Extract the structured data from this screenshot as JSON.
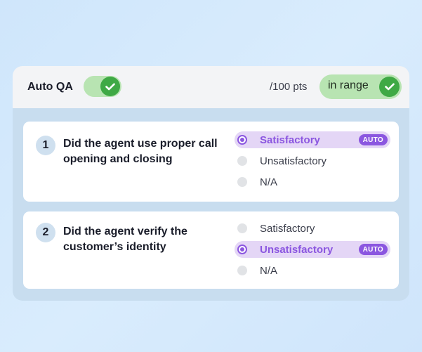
{
  "header": {
    "title": "Auto QA",
    "toggle_on": true,
    "score_text": "/100 pts",
    "range_label": "in range"
  },
  "questions": [
    {
      "number": "1",
      "text": "Did the agent use proper call opening and closing",
      "options": [
        {
          "label": "Satisfactory",
          "selected": true,
          "badge": "AUTO"
        },
        {
          "label": "Unsatisfactory",
          "selected": false
        },
        {
          "label": "N/A",
          "selected": false
        }
      ]
    },
    {
      "number": "2",
      "text": "Did the agent verify the customer’s identity",
      "options": [
        {
          "label": "Satisfactory",
          "selected": false
        },
        {
          "label": "Unsatisfactory",
          "selected": true,
          "badge": "AUTO"
        },
        {
          "label": "N/A",
          "selected": false
        }
      ]
    }
  ],
  "colors": {
    "accent_purple": "#8b56e0",
    "success_green": "#3fa945",
    "pill_green": "#b8e4b2"
  },
  "icons": {
    "toggle": "check-icon",
    "range": "check-icon"
  }
}
